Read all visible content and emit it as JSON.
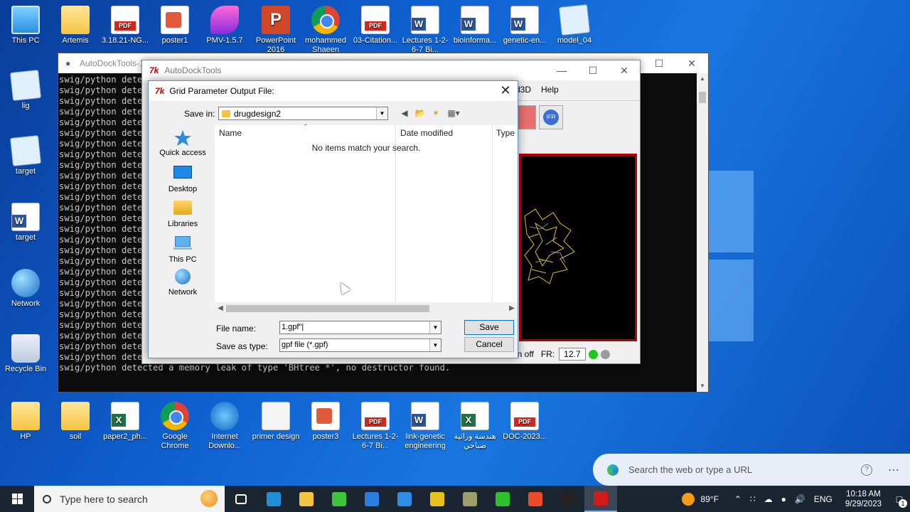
{
  "desktop": {
    "top_icons": [
      {
        "label": "This PC",
        "type": "pc"
      },
      {
        "label": "Artemis",
        "type": "folder"
      },
      {
        "label": "3.18.21-NG...",
        "type": "pdf"
      },
      {
        "label": "poster1",
        "type": "poster"
      },
      {
        "label": "PMV-1.5.7",
        "type": "pmv"
      },
      {
        "label": "PowerPoint 2016",
        "type": "ppt"
      },
      {
        "label": "mohammed Shaeen",
        "type": "chrome"
      },
      {
        "label": "03-Citation...",
        "type": "pdf"
      },
      {
        "label": "Lectures 1-2-6-7 Bi...",
        "type": "doc"
      },
      {
        "label": "bioinforma...",
        "type": "doc"
      },
      {
        "label": "genetic-en...",
        "type": "doc"
      },
      {
        "label": "model_04",
        "type": "note"
      }
    ],
    "left_icons": [
      {
        "label": "lig",
        "type": "note"
      },
      {
        "label": "target",
        "type": "note"
      },
      {
        "label": "target",
        "type": "doc"
      },
      {
        "label": "Network",
        "type": "globe"
      },
      {
        "label": "Recycle Bin",
        "type": "recycle"
      }
    ],
    "bottom_icons": [
      {
        "label": "HP",
        "type": "user"
      },
      {
        "label": "soil",
        "type": "folder"
      },
      {
        "label": "paper2_ph...",
        "type": "xls"
      },
      {
        "label": "Google Chrome",
        "type": "chrome"
      },
      {
        "label": "Internet Downlo...",
        "type": "ie"
      },
      {
        "label": "primer design",
        "type": "file"
      },
      {
        "label": "poster3",
        "type": "poster"
      },
      {
        "label": "Lectures 1-2-6-7 Bi...",
        "type": "pdf"
      },
      {
        "label": "link-genetic engineering",
        "type": "doc"
      },
      {
        "label": "هندسة وراثية صباحي",
        "type": "xls"
      },
      {
        "label": "DOC-2023...",
        "type": "pdf"
      }
    ]
  },
  "console": {
    "title": "AutoDockTools-1.5",
    "lines": [
      "swig/python dete",
      "swig/python dete",
      "swig/python dete",
      "swig/python dete",
      "swig/python dete",
      "swig/python dete",
      "swig/python dete",
      "swig/python dete",
      "swig/python dete",
      "swig/python dete",
      "swig/python dete",
      "swig/python dete",
      "swig/python dete",
      "swig/python dete",
      "swig/python dete",
      "swig/python dete",
      "swig/python dete",
      "swig/python dete",
      "swig/python dete",
      "swig/python dete",
      "swig/python dete",
      "swig/python dete",
      "swig/python dete",
      "swig/python dete",
      "swig/python dete",
      "swig/python dete",
      "swig/python detected a memory leak of type 'BHtree *', no destructor found.",
      "swig/python detected a memory leak of type 'BHtree *', no destructor found."
    ]
  },
  "adt": {
    "title": "AutoDockTools",
    "menu": [
      "d3D",
      "Help"
    ],
    "status_left": "in off",
    "fr_label": "FR:",
    "fr_value": "12.7",
    "led_colors": [
      "#1ec81e",
      "#9a9a9a"
    ]
  },
  "dialog": {
    "title": "Grid Parameter Output File:",
    "save_in_label": "Save in:",
    "save_in_value": "drugdesign2",
    "places": [
      "Quick access",
      "Desktop",
      "Libraries",
      "This PC",
      "Network"
    ],
    "columns": [
      "Name",
      "Date modified",
      "Type"
    ],
    "empty_message": "No items match your search.",
    "file_name_label": "File name:",
    "file_name_value": "1.gpf\"|",
    "save_as_type_label": "Save as type:",
    "save_as_type_value": "gpf file (*.gpf)",
    "save_button": "Save",
    "cancel_button": "Cancel"
  },
  "edge_bar": {
    "placeholder": "Search the web or type a URL"
  },
  "taskbar": {
    "search_placeholder": "Type here to search",
    "weather": "89°F",
    "language": "ENG",
    "time": "10:18 AM",
    "date": "9/29/2023",
    "notification_count": "1",
    "apps": [
      {
        "name": "task-view",
        "color": "#ffffff"
      },
      {
        "name": "edge",
        "color": "#1f8fd6"
      },
      {
        "name": "file-explorer",
        "color": "#f5c542"
      },
      {
        "name": "pymol",
        "color": "#3ec43e"
      },
      {
        "name": "store",
        "color": "#2a7de1"
      },
      {
        "name": "mail",
        "color": "#2f8de4"
      },
      {
        "name": "babel",
        "color": "#e8c21a"
      },
      {
        "name": "screen-tool",
        "color": "#9e9e6a"
      },
      {
        "name": "camtasia",
        "color": "#2dc12d"
      },
      {
        "name": "camtasia-red",
        "color": "#ea4b28"
      },
      {
        "name": "terminal",
        "color": "#222222"
      },
      {
        "name": "autodocktools",
        "color": "#d11a1a"
      }
    ]
  }
}
